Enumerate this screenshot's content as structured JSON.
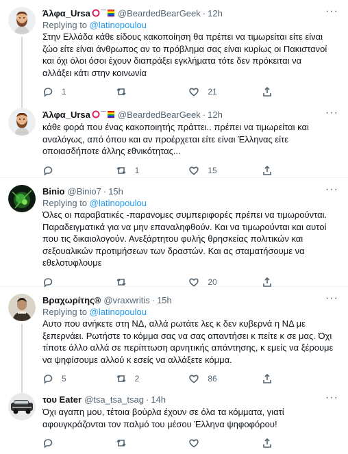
{
  "tweets": [
    {
      "name": "Άλφα_Ursa",
      "handle": "@BeardedBearGeek",
      "time": "12h",
      "reply_to_prefix": "Replying to ",
      "reply_to": "@latinopoulou",
      "text": "Στην Ελλάδα κάθε είδους κακοποίηση θα πρέπει να τιμωρείται είτε είναι\nζώο είτε είναι άνθρωπος αν το πρόβλημα σας είναι κυρίως οι Πακιστανοί\nκαι όχι όλοι όσοι έχουν διαπράξει εγκλήματα τότε δεν πρόκειται να\nαλλάξει κάτι στην κοινωνία",
      "replies": "1",
      "retweets": "",
      "likes": "21",
      "avatar": "memoji-bearded-man"
    },
    {
      "name": "Άλφα_Ursa",
      "handle": "@BeardedBearGeek",
      "time": "12h",
      "reply_to_prefix": "",
      "reply_to": "",
      "text": "κάθε φορά που ένας κακοποιητής πράττει.. πρέπει να τιμωρείται και\nαναλόγως, από όπου και αν προέρχεται είτε είναι Έλληνας είτε\nοποιασδήποτε άλλης εθνικότητας...",
      "replies": "",
      "retweets": "1",
      "likes": "15",
      "avatar": "memoji-bearded-man"
    },
    {
      "name": "Binio",
      "handle": "@Binio7",
      "time": "15h",
      "reply_to_prefix": "Replying to ",
      "reply_to": "@latinopoulou",
      "text": "Όλες οι παραβατικές -παρανομες συμπεριφορές πρέπει να τιμωρούνται.\nΠαραδειγματικά για να μην επαναληφθούν. Και να τιμωρούνται και αυτοί\nπου τις δικαιολογούν. Ανεξάρτητου φυλής θρησκείας πολιτικών και\nσεξουαλικών προτιμήσεων των δραστών. Και ας σταματήσουμε να\nεθελοτυφλουμε",
      "replies": "",
      "retweets": "",
      "likes": "20",
      "avatar": "green-abstract"
    },
    {
      "name": "Βραχωρίτης®",
      "handle": "@vraxwritis",
      "time": "15h",
      "reply_to_prefix": "Replying to ",
      "reply_to": "@latinopoulou",
      "text": "Αυτο που ανήκετε στη ΝΔ, αλλά ρωτάτε λες κ δεν κυβερνά η ΝΔ με\nξεπερνάει. Ρωτήστε το κόμμα σας να σας απαντήσει κ πείτε κ σε μας. Όχι\nτίποτε άλλο αλλά σε περίπτωση αρνητικής απάντησης, κ εμείς να ξέρουμε\nνα ψηφίσουμε αλλού κ εσείς να αλλάξετε κόμμα.",
      "replies": "5",
      "retweets": "2",
      "likes": "86",
      "avatar": "man-portrait"
    },
    {
      "name": "του Eater",
      "handle": "@tsa_tsa_tsag",
      "time": "14h",
      "reply_to_prefix": "",
      "reply_to": "",
      "text": "Όχι αγαπη μου, τέτοια βούρλα έχουν σε όλα τα κόμματα, γιατί\nαφουγκράζονται τον παλμό του μέσου Έλληνα ψηφοφόρου!",
      "replies": "",
      "retweets": "",
      "likes": "",
      "avatar": "car-photo"
    }
  ],
  "colors": {
    "accent": "#1d9bf0",
    "secondary_text": "#536471",
    "primary_text": "#0f1419",
    "divider": "#eff3f4"
  },
  "icons": {
    "reply": "reply-icon",
    "retweet": "retweet-icon",
    "like": "heart-icon",
    "share": "share-icon",
    "more": "more-icon"
  }
}
